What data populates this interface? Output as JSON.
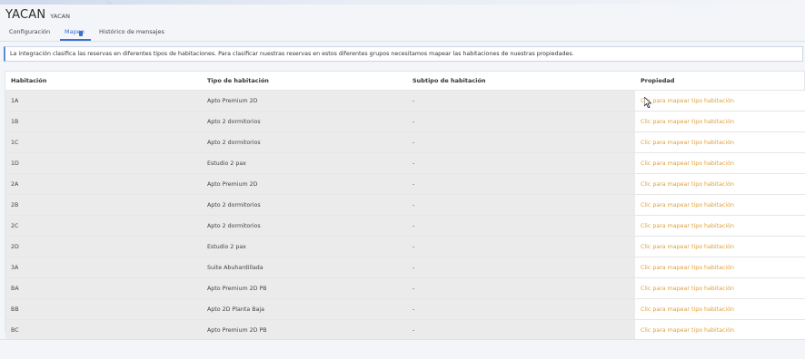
{
  "header": {
    "title": "YACAN",
    "subtitle": "YACAN"
  },
  "tabs": [
    {
      "label": "Configuración"
    },
    {
      "label": "Mapeo"
    },
    {
      "label": "Histórico de mensajes"
    }
  ],
  "info_text": "La integración clasifica las reservas en diferentes tipos de habitaciones. Para clasificar nuestras reservas en estos diferentes grupos necesitamos mapear las habitaciones de nuestras propiedades.",
  "table": {
    "columns": [
      "Habitación",
      "Tipo de habitación",
      "Subtipo de habitación",
      "Propiedad"
    ],
    "rows": [
      {
        "room": "1A",
        "type": "Apto Premium 2D",
        "subtype": "-",
        "property": "Clic para mapear tipo habitación"
      },
      {
        "room": "1B",
        "type": "Apto 2 dormitorios",
        "subtype": "-",
        "property": "Clic para mapear tipo habitación"
      },
      {
        "room": "1C",
        "type": "Apto 2 dormitorios",
        "subtype": "-",
        "property": "Clic para mapear tipo habitación"
      },
      {
        "room": "1D",
        "type": "Estudio 2 pax",
        "subtype": "-",
        "property": "Clic para mapear tipo habitación"
      },
      {
        "room": "2A",
        "type": "Apto Premium 2D",
        "subtype": "-",
        "property": "Clic para mapear tipo habitación"
      },
      {
        "room": "2B",
        "type": "Apto 2 dormitorios",
        "subtype": "-",
        "property": "Clic para mapear tipo habitación"
      },
      {
        "room": "2C",
        "type": "Apto 2 dormitorios",
        "subtype": "-",
        "property": "Clic para mapear tipo habitación"
      },
      {
        "room": "2D",
        "type": "Estudio 2 pax",
        "subtype": "-",
        "property": "Clic para mapear tipo habitación"
      },
      {
        "room": "3A",
        "type": "Suite Abuhardillada",
        "subtype": "-",
        "property": "Clic para mapear tipo habitación"
      },
      {
        "room": "BA",
        "type": "Apto Premium 2D PB",
        "subtype": "-",
        "property": "Clic para mapear tipo habitación"
      },
      {
        "room": "BB",
        "type": "Apto 2D Planta Baja",
        "subtype": "-",
        "property": "Clic para mapear tipo habitación"
      },
      {
        "room": "BC",
        "type": "Apto Premium 2D PB",
        "subtype": "-",
        "property": "Clic para mapear tipo habitación"
      }
    ]
  },
  "colors": {
    "accent": "#3d6fd0",
    "link": "#e0a13a",
    "row_bg": "#ebebeb"
  },
  "cursor": {
    "icon": "mouse-pointer-icon"
  }
}
